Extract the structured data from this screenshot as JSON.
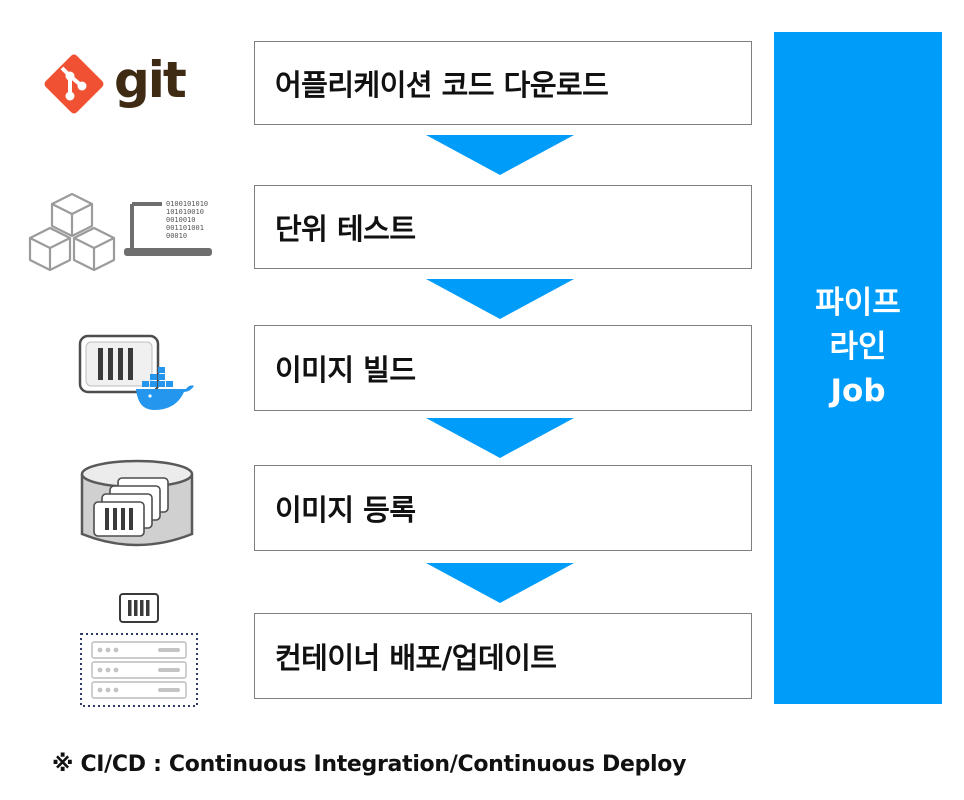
{
  "steps": [
    {
      "label": "어플리케이션 코드 다운로드",
      "icon": "git-logo-icon"
    },
    {
      "label": "단위 테스트",
      "icon": "unit-test-cubes-laptop-icon"
    },
    {
      "label": "이미지 빌드",
      "icon": "container-image-docker-icon"
    },
    {
      "label": "이미지 등록",
      "icon": "image-registry-database-icon"
    },
    {
      "label": "컨테이너 배포/업데이트",
      "icon": "server-rack-container-icon"
    }
  ],
  "git_logo_text": "git",
  "laptop_binary": [
    "0100101010",
    "101010010",
    "0010010",
    "001101001",
    "00010"
  ],
  "pipeline": {
    "lines": [
      "파이프",
      "라인",
      "Job"
    ]
  },
  "footnote": "※ CI/CD : Continuous Integration/Continuous Deploy",
  "colors": {
    "accent": "#009cfa",
    "git": "#f05133",
    "box_border": "#7f7f7f",
    "icon_gray": "#8a8a8a"
  }
}
